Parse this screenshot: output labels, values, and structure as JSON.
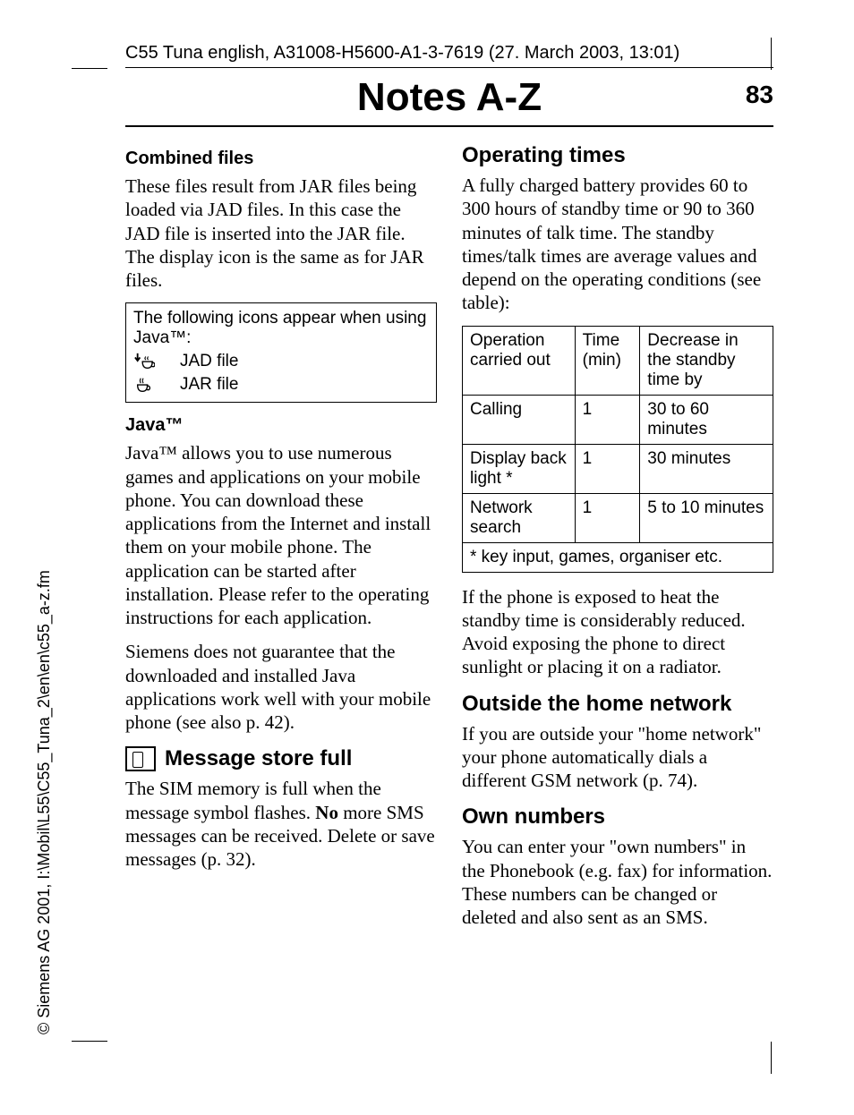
{
  "sideways": "© Siemens AG 2001, I:\\Mobil\\L55\\C55_Tuna_2\\en\\en\\c55_a-z.fm",
  "running_head": "C55 Tuna english, A31008-H5600-A1-3-7619 (27. March 2003, 13:01)",
  "chapter_title": "Notes A-Z",
  "page_number": "83",
  "left": {
    "combined": {
      "heading": "Combined files",
      "body": "These files result from JAR files being loaded via JAD files. In this case the JAD file is inserted into the JAR file. The display icon is the same as for JAR files."
    },
    "box": {
      "intro": "The following icons appear when using Java™:",
      "jad": "JAD file",
      "jar": "JAR file"
    },
    "java": {
      "heading": "Java™",
      "p1": "Java™ allows you to use numerous games and applications on your mobile phone. You can download these applications from the Internet and install them on your mobile phone. The application can be started after installation. Please refer to the operating instructions for each application.",
      "p2": "Siemens does not guarantee that the downloaded and installed Java applications work well with your mobile phone (see also p. 42)."
    },
    "msgfull": {
      "heading": "Message store full",
      "p_pre": "The SIM memory is full when the message symbol flashes. ",
      "no_word": "No",
      "p_post": " more SMS messages can be received. Delete or save messages (p. 32)."
    }
  },
  "right": {
    "operating": {
      "heading": "Operating times",
      "body": "A fully charged battery provides 60 to 300 hours of standby time or 90 to 360 minutes of talk time. The standby times/talk times are average values and depend on the operating conditions (see table):",
      "after": "If the phone is exposed to heat the standby time is considerably reduced. Avoid exposing the phone to direct sunlight or placing it on a radiator."
    },
    "table": {
      "h1": "Operation carried out",
      "h2": "Time (min)",
      "h3": "Decrease in the standby time by",
      "rows": [
        {
          "op": "Calling",
          "time": "1",
          "dec": "30 to 60 minutes"
        },
        {
          "op": "Display back light *",
          "time": "1",
          "dec": "30 minutes"
        },
        {
          "op": "Network search",
          "time": "1",
          "dec": "5 to 10 minutes"
        }
      ],
      "foot": "* key input, games, organiser etc."
    },
    "outside": {
      "heading": "Outside the home network",
      "body": "If you are outside your \"home network\" your phone automatically dials a different GSM network (p. 74)."
    },
    "own": {
      "heading": "Own numbers",
      "body": "You can enter your \"own numbers\" in the Phonebook (e.g. fax) for information. These numbers can be changed or deleted and also sent as an SMS."
    }
  }
}
